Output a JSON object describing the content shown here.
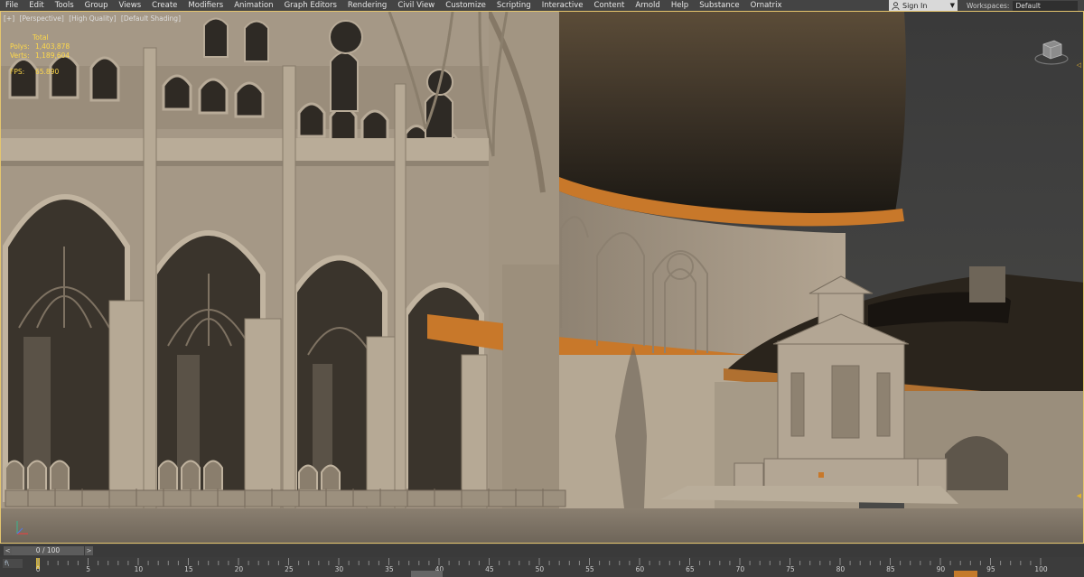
{
  "menu": {
    "items": [
      "File",
      "Edit",
      "Tools",
      "Group",
      "Views",
      "Create",
      "Modifiers",
      "Animation",
      "Graph Editors",
      "Rendering",
      "Civil View",
      "Customize",
      "Scripting",
      "Interactive",
      "Content",
      "Arnold",
      "Help",
      "Substance",
      "Ornatrix"
    ]
  },
  "signin": {
    "label": "Sign In",
    "icon": "user-icon"
  },
  "workspaces": {
    "label": "Workspaces:",
    "value": "Default"
  },
  "viewport": {
    "labels": [
      "[+]",
      "[Perspective]",
      "[High Quality]",
      "[Default Shading]"
    ],
    "stats": {
      "total_label": "Total",
      "polys_label": "Polys:",
      "polys_value": "1,403,878",
      "verts_label": "Verts:",
      "verts_value": "1,189,604",
      "fps_label": "FPS:",
      "fps_value": "65.890"
    }
  },
  "timeslider": {
    "value": "0 / 100",
    "prev": "<",
    "next": ">"
  },
  "trackbar": {
    "curve_label": "f\\",
    "ticks": [
      "0",
      "5",
      "10",
      "15",
      "20",
      "25",
      "30",
      "35",
      "40",
      "45",
      "50",
      "55",
      "60",
      "65",
      "70",
      "75",
      "80",
      "85",
      "90",
      "95",
      "100"
    ]
  },
  "colors": {
    "viewport_border": "#e4c56e",
    "stats_text": "#ffd94a",
    "orange_trim": "#c8782a",
    "stone": "#a89a88"
  }
}
